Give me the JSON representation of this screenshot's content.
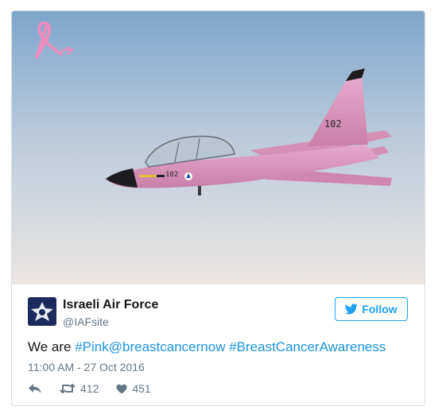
{
  "photo": {
    "subject": "pink-fighter-jet",
    "tail_number": "102",
    "nose_number": "102",
    "colors": {
      "sky_top": "#7ea6cc",
      "sky_bottom": "#e9e4e1",
      "jet_body": "#dc98bd",
      "ribbon": "#ec8dbf"
    }
  },
  "tweet": {
    "author_name": "Israeli Air Force",
    "author_handle": "@IAFsite",
    "follow_label": "Follow",
    "text_prefix": "We are ",
    "hashtag_pink": "#Pink",
    "mention": "@breastcancernow",
    "hashtag_awareness": "#BreastCancerAwareness",
    "timestamp": "11:00 AM - 27 Oct 2016",
    "retweet_count": "412",
    "like_count": "451"
  },
  "icons": {
    "follow": "twitter-bird-icon",
    "reply": "reply-icon",
    "retweet": "retweet-icon",
    "like": "heart-icon"
  },
  "colors": {
    "accent": "#1da1f2",
    "link": "#1b95e0",
    "muted": "#657786",
    "text": "#14171a"
  }
}
